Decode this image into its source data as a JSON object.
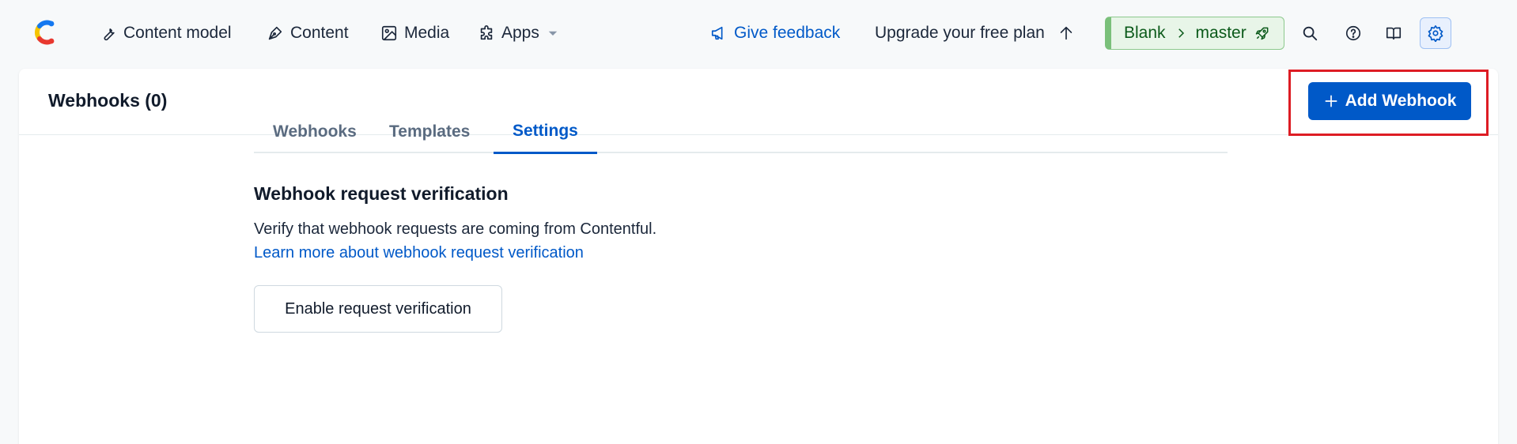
{
  "nav": {
    "items": [
      {
        "label": "Content model",
        "icon": "wrench-icon"
      },
      {
        "label": "Content",
        "icon": "pen-icon"
      },
      {
        "label": "Media",
        "icon": "image-icon"
      },
      {
        "label": "Apps",
        "icon": "puzzle-icon"
      }
    ],
    "feedback_label": "Give feedback",
    "upgrade_label": "Upgrade your free plan",
    "env": {
      "space": "Blank",
      "environment": "master"
    }
  },
  "header": {
    "title": "Webhooks (0)",
    "add_button_label": "Add Webhook"
  },
  "tabs": [
    {
      "label": "Webhooks",
      "active": false
    },
    {
      "label": "Templates",
      "active": false
    },
    {
      "label": "Settings",
      "active": true
    }
  ],
  "settings": {
    "section_title": "Webhook request verification",
    "description": "Verify that webhook requests are coming from Contentful.",
    "link_text": "Learn more about webhook request verification",
    "enable_button_label": "Enable request verification"
  },
  "colors": {
    "primary": "#0059c8",
    "highlight": "#dd1c24",
    "env_green": "#0b5a1a"
  }
}
